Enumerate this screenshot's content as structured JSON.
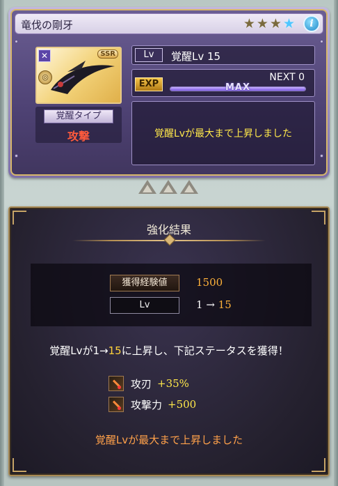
{
  "weapon": {
    "name": "竜伐の剛牙",
    "stars": [
      {
        "filled": true,
        "color": "gold"
      },
      {
        "filled": true,
        "color": "gold"
      },
      {
        "filled": true,
        "color": "gold"
      },
      {
        "filled": true,
        "color": "blue"
      }
    ],
    "rarity": "SSR",
    "awakening_type_label": "覚醒タイプ",
    "awakening_type": "攻撃",
    "level_tag": "Lv",
    "level_text": "覚醒Lv 15",
    "exp_tag": "EXP",
    "next_text": "NEXT 0",
    "exp_progress": 1.0,
    "max_label": "MAX",
    "message": "覚醒Lvが最大まで上昇しました"
  },
  "result": {
    "title": "強化結果",
    "exp_gain_label": "獲得経験値",
    "exp_gain_value": "1500",
    "level_label": "Lv",
    "level_from": "1",
    "level_arrow": " → ",
    "level_to": "15",
    "sentence_prefix": "覚醒Lvが",
    "sentence_from": "1→",
    "sentence_to": "15",
    "sentence_suffix": "に上昇し、下記ステータスを獲得！",
    "skills": [
      {
        "name": "攻刃",
        "value": "+35%"
      },
      {
        "name": "攻撃力",
        "value": "+500"
      }
    ],
    "message": "覚醒Lvが最大まで上昇しました"
  },
  "colors": {
    "accent_gold": "#ffb23a",
    "message_yellow": "#ffe84a",
    "attack_red": "#ff5a3c",
    "result_message_orange": "#ffa14a"
  }
}
